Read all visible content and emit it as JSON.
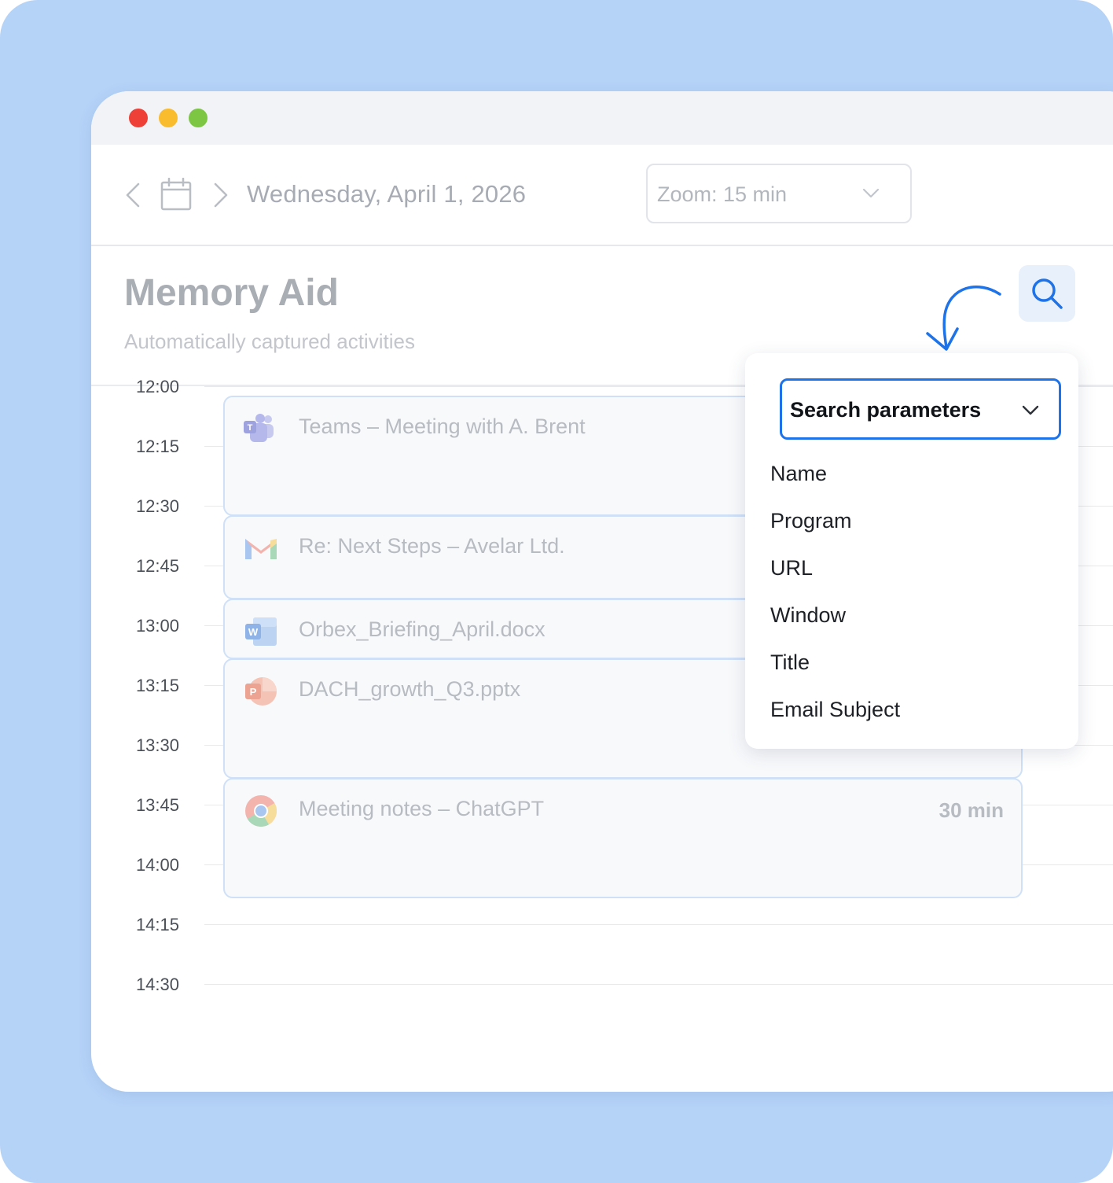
{
  "window": {
    "traffic_lights": [
      "#ee4037",
      "#f9bc2f",
      "#7cc644"
    ]
  },
  "toolbar": {
    "date": "Wednesday, April 1, 2026",
    "zoom": "Zoom: 15 min",
    "icons": [
      "chevron-left-icon",
      "calendar-icon",
      "chevron-right-icon",
      "chevron-down-icon"
    ]
  },
  "header": {
    "title": "Memory Aid",
    "subtitle": "Automatically captured activities",
    "search_icon": "search-icon"
  },
  "timeline": {
    "times": [
      "12:00",
      "12:15",
      "12:30",
      "12:45",
      "13:00",
      "13:15",
      "13:30",
      "13:45",
      "14:00",
      "14:15",
      "14:30"
    ],
    "events": [
      {
        "app": "teams-icon",
        "title": "Teams – Meeting with A. Brent",
        "duration": ""
      },
      {
        "app": "gmail-icon",
        "title": "Re: Next Steps – Avelar Ltd.",
        "duration": ""
      },
      {
        "app": "word-icon",
        "title": "Orbex_Briefing_April.docx",
        "duration": ""
      },
      {
        "app": "powerpoint-icon",
        "title": "DACH_growth_Q3.pptx",
        "duration": ""
      },
      {
        "app": "chrome-icon",
        "title": "Meeting notes – ChatGPT",
        "duration": "30 min"
      }
    ]
  },
  "search_dropdown": {
    "label": "Search parameters",
    "options": [
      "Name",
      "Program",
      "URL",
      "Window",
      "Title",
      "Email Subject"
    ]
  },
  "colors": {
    "background": "#b5d2f7",
    "accent": "#1f73e8",
    "event_border": "#cfe0f7"
  }
}
